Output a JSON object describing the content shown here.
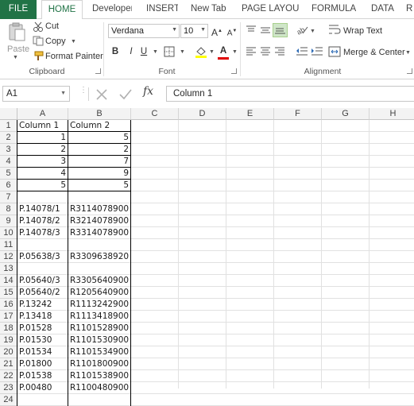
{
  "tabs": [
    "FILE",
    "HOME",
    "Developer",
    "INSERT",
    "New Tab",
    "PAGE LAYOUT",
    "FORMULAS",
    "DATA",
    "R"
  ],
  "clipboard": {
    "paste": "Paste",
    "cut": "Cut",
    "copy": "Copy",
    "format_painter": "Format Painter",
    "label": "Clipboard"
  },
  "font": {
    "name": "Verdana",
    "size": "10",
    "label": "Font",
    "bold": "B",
    "italic": "I",
    "underline": "U"
  },
  "alignment": {
    "wrap_text": "Wrap Text",
    "merge_center": "Merge & Center",
    "label": "Alignment"
  },
  "formula_bar": {
    "name_box": "A1",
    "fx": "fx",
    "content": "Column 1"
  },
  "columns": [
    "A",
    "B",
    "C",
    "D",
    "E",
    "F",
    "G",
    "H"
  ],
  "rows": [
    "1",
    "2",
    "3",
    "4",
    "5",
    "6",
    "7",
    "8",
    "9",
    "10",
    "11",
    "12",
    "13",
    "14",
    "15",
    "16",
    "17",
    "18",
    "19",
    "20",
    "21",
    "22",
    "23",
    "24"
  ],
  "cells": {
    "A": [
      "Column 1",
      "1",
      "2",
      "3",
      "4",
      "5",
      "",
      "P.14078/1",
      "P.14078/2",
      "P.14078/3",
      "",
      "P.05638/3",
      "",
      "P.05640/3",
      "P.05640/2",
      "P.13242",
      "P.13418",
      "P.01528",
      "P.01530",
      "P.01534",
      "P.01800",
      "P.01538",
      "P.00480",
      ""
    ],
    "B": [
      "Column 2",
      "5",
      "2",
      "7",
      "9",
      "5",
      "",
      "R3114078900",
      "R3214078900",
      "R3314078900",
      "",
      "R3309638920",
      "",
      "R3305640900",
      "R1205640900",
      "R1113242900",
      "R1113418900",
      "R1101528900",
      "R1101530900",
      "R1101534900",
      "R1101800900",
      "R1101538900",
      "R1100480900",
      ""
    ]
  },
  "colors": {
    "accent": "#217346",
    "header_bg": "#f3f3f3",
    "gridline": "#e1e1e1"
  }
}
